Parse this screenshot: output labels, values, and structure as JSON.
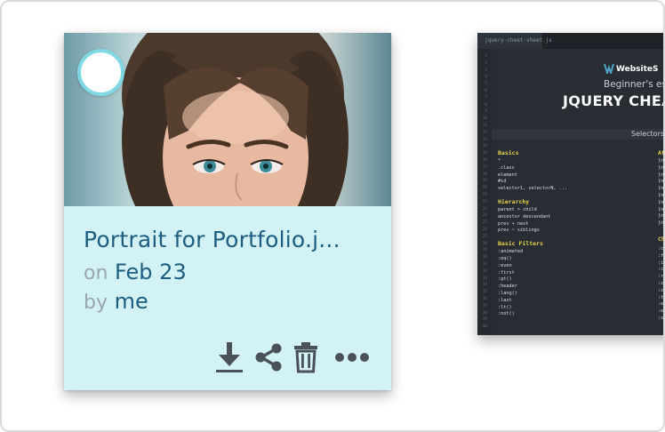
{
  "photo_card": {
    "title": "Portrait for Portfolio.j...",
    "date_prefix": "on",
    "date": "Feb 23",
    "owner_prefix": "by",
    "owner": "me",
    "actions": [
      {
        "name": "download-icon"
      },
      {
        "name": "share-icon"
      },
      {
        "name": "trash-icon"
      },
      {
        "name": "more-icon"
      }
    ],
    "colors": {
      "info_bg": "#d3f2f6",
      "accent": "#1d5e80",
      "muted": "#9aa7ad",
      "select_ring": "#7fd8e2",
      "icon": "#4a5258"
    }
  },
  "code_card": {
    "tab": "jquery-cheat-sheet.js",
    "brand": "WebsiteS",
    "subtitle": "Beginner's es",
    "title": "JQUERY CHEA",
    "section": "Selectors",
    "heading_color": "#e8d44d",
    "groups": [
      {
        "heading": "Basics",
        "lines": [
          "*",
          ".class",
          "element",
          "#id",
          "selector1, selectorN, ..."
        ]
      },
      {
        "heading": "Hierarchy",
        "lines": [
          "parent > child",
          "ancestor descendant",
          "prev + next",
          "prev ~ siblings"
        ]
      },
      {
        "heading": "Basic Filters",
        "lines": [
          ":animated",
          ":eq()",
          ":even",
          ":first",
          ":gt()",
          ":header",
          ":lang()",
          ":last",
          ":lt()",
          ":not()"
        ]
      }
    ],
    "right_heading_1": "At",
    "right_heading_2": "Ch",
    "right_lines_1": [
      "[n",
      "[n",
      "[n",
      "[n",
      "[n",
      "[n",
      "[n",
      "[n",
      "[n",
      "[n"
    ],
    "right_lines_2": [
      ":c",
      ":f",
      ":i",
      ":c",
      ":r",
      ":s",
      ":s",
      ":t",
      ":e",
      ":e",
      ":s"
    ],
    "line_numbers": [
      "1",
      "2",
      "3",
      "4",
      "5",
      "6",
      "7",
      "8",
      "9",
      "10",
      "11",
      "12",
      "13",
      "14",
      "15",
      "16",
      "17",
      "18",
      "19",
      "20",
      "21",
      "22",
      "23",
      "24",
      "25",
      "26",
      "27",
      "28",
      "29",
      "30",
      "31",
      "32",
      "33",
      "34",
      "35",
      "36",
      "37",
      "38",
      "39",
      "40"
    ]
  }
}
